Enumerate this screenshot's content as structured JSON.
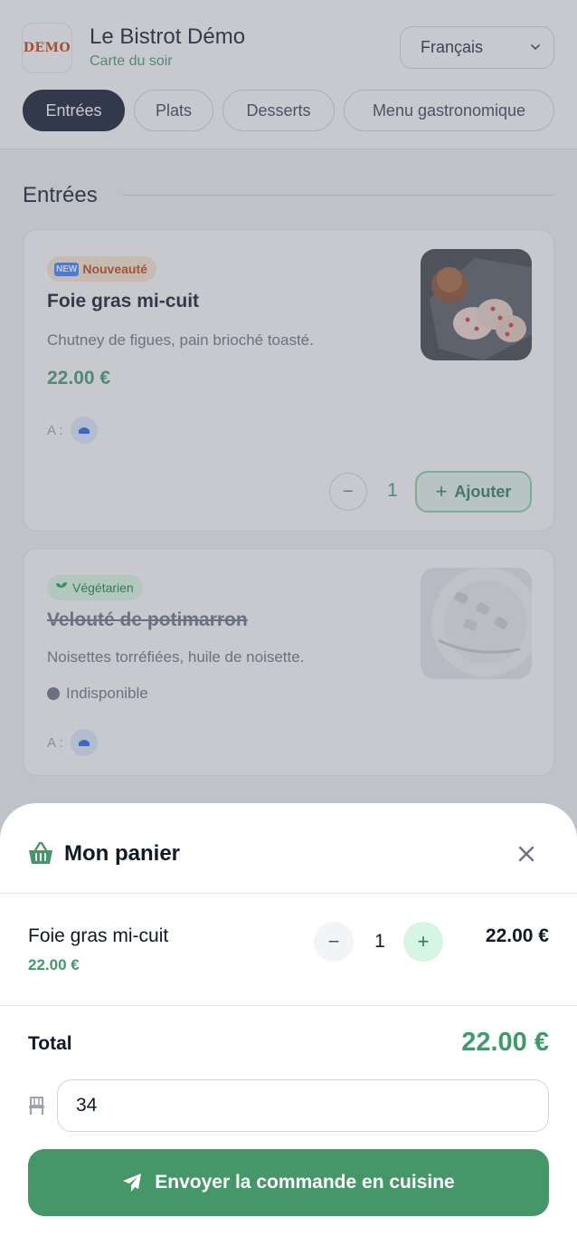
{
  "header": {
    "logo_text": "DEMO",
    "restaurant_name": "Le Bistrot Démo",
    "subtitle": "Carte du soir",
    "language": "Français"
  },
  "tabs": [
    {
      "label": "Entrées",
      "active": true
    },
    {
      "label": "Plats",
      "active": false
    },
    {
      "label": "Desserts",
      "active": false
    },
    {
      "label": "Menu gastronomique",
      "active": false
    }
  ],
  "section": {
    "title": "Entrées"
  },
  "dishes": [
    {
      "badge": "Nouveauté",
      "badge_icon": "NEW",
      "name": "Foie gras mi-cuit",
      "description": "Chutney de figues, pain brioché toasté.",
      "price": "22.00 €",
      "allergen_label": "A :",
      "quantity": "1",
      "add_label": "Ajouter",
      "available": true
    },
    {
      "badge": "Végétarien",
      "name": "Velouté de potimarron",
      "description": "Noisettes torréfiées, huile de noisette.",
      "status": "Indisponible",
      "allergen_label": "A :",
      "available": false
    }
  ],
  "cart": {
    "title": "Mon panier",
    "items": [
      {
        "name": "Foie gras mi-cuit",
        "unit_price": "22.00 €",
        "quantity": "1",
        "line_total": "22.00 €"
      }
    ],
    "total_label": "Total",
    "total_value": "22.00 €",
    "table_number": "34",
    "send_label": "Envoyer la commande en cuisine"
  },
  "colors": {
    "accent_green": "#46966a",
    "price_green": "#3f9a6b",
    "active_tab": "#0f172a"
  }
}
